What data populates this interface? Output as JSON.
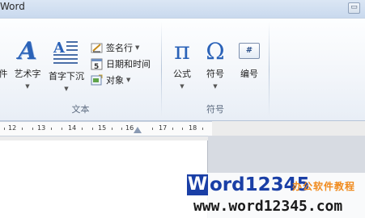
{
  "titlebar": {
    "title": "Word",
    "button_glyph": "▭"
  },
  "ribbon": {
    "big_buttons": [
      {
        "label": "件"
      },
      {
        "label": "艺术字"
      },
      {
        "label": "首字下沉"
      },
      {
        "label": "公式"
      },
      {
        "label": "符号"
      },
      {
        "label": "编号"
      }
    ],
    "small_buttons": [
      {
        "label": "签名行"
      },
      {
        "label": "日期和时间"
      },
      {
        "label": "对象"
      }
    ],
    "groups": {
      "text": "文本",
      "symbols": "符号"
    },
    "glyphs": {
      "wordart": "A",
      "pi": "π",
      "omega": "Ω",
      "number": "#",
      "date_icon": "5"
    }
  },
  "ruler": {
    "labels": [
      "12",
      "13",
      "14",
      "15",
      "16",
      "17",
      "18"
    ]
  },
  "watermark": {
    "brand_w": "W",
    "brand_rest": "ord12345",
    "tagline": "办公软件教程",
    "url": "www.word12345.com"
  },
  "colors": {
    "watermark_blue": "#1a3fa6",
    "watermark_orange": "#f08a1c",
    "glyph_blue": "#2a62b8"
  }
}
